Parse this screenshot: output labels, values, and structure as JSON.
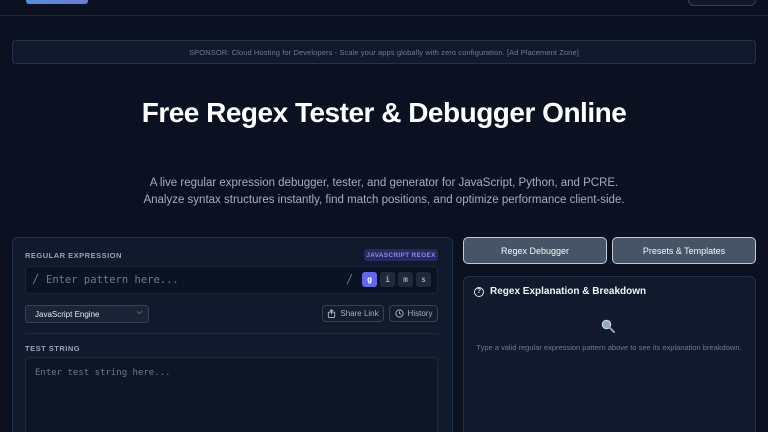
{
  "sponsor": {
    "text": "SPONSOR: Cloud Hosting for Developers - Scale your apps globally with zero configuration. [Ad Placement Zone]"
  },
  "hero": {
    "title": "Free Regex Tester & Debugger Online",
    "subtitle": "A live regular expression debugger, tester, and generator for JavaScript, Python, and PCRE. Analyze syntax structures instantly, find match positions, and optimize performance client-side."
  },
  "editor": {
    "regex_label": "REGULAR EXPRESSION",
    "badge": "JAVASCRIPT REGEX",
    "open_slash": "/",
    "close_slash": "/",
    "pattern_placeholder": "Enter pattern here...",
    "pattern_value": "",
    "flags": [
      {
        "label": "g",
        "active": true
      },
      {
        "label": "i",
        "active": false
      },
      {
        "label": "m",
        "active": false
      },
      {
        "label": "s",
        "active": false
      }
    ],
    "engine_selected": "JavaScript Engine",
    "share_label": "Share Link",
    "history_label": "History",
    "test_label": "TEST STRING",
    "test_placeholder": "Enter test string here..."
  },
  "tabs": [
    {
      "label": "Regex Debugger"
    },
    {
      "label": "Presets & Templates"
    }
  ],
  "explanation": {
    "title": "Regex Explanation & Breakdown",
    "empty_message": "Type a valid regular expression pattern above to see its explanation breakdown."
  },
  "icons": {
    "help": "help-circle-icon",
    "share": "share-icon",
    "history": "clock-icon",
    "search": "magnifier-icon",
    "dropdown": "chevron-down-icon"
  },
  "colors": {
    "background": "#0b1120",
    "accent": "#6366f1",
    "badge_text": "#818cf8"
  }
}
